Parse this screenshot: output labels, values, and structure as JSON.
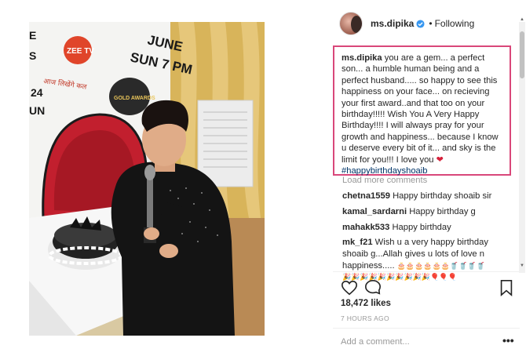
{
  "post": {
    "username": "ms.dipika",
    "separator": "•",
    "follow_state": "Following",
    "photo": {
      "banner_top": "JUNE",
      "banner_time": "SUN 7 PM",
      "brand": "ZEE TV",
      "brand_tagline": "आज लिखेंगे कल",
      "awards_logo": "GOLD AWARDS",
      "side_text_24": "24",
      "side_text_un": "UN"
    }
  },
  "caption": {
    "username": "ms.dipika",
    "text": "you are a gem... a perfect son... a humble human being and a perfect husband..... so happy to see this happiness on your face... on recieving your first award..and that too on your birthday!!!!! Wish You A Very Happy Birthday!!!! I will always pray for your growth and happiness... because I know u deserve every bit of it... and sky is the limit for you!!! I love you",
    "heart": "❤",
    "hashtag": "#happybirthdayshoaib"
  },
  "load_more": "Load more comments",
  "comments": [
    {
      "user": "chetna1559",
      "text": "Happy birthday shoaib sir"
    },
    {
      "user": "kamal_sardarni",
      "text": "Happy birthday g"
    },
    {
      "user": "mahakk533",
      "text": "Happy birthday"
    },
    {
      "user": "mk_f21",
      "text": "Wish u a very happy birthday shoaib g...Allah gives u lots of love n happiness....."
    }
  ],
  "emoji_row_1": "🎂🎂🎂🎂🎂🎂🥤🥤🥤🥤",
  "emoji_row_2": "🎉🎉🎉🎉🎉🎉🎉🎉🎉🎉🎈🎈🎈",
  "actions": {
    "like_icon": "heart-outline-icon",
    "comment_icon": "speech-bubble-icon",
    "save_icon": "bookmark-icon"
  },
  "likes": "18,472 likes",
  "time_ago": "7 HOURS AGO",
  "comment_placeholder": "Add a comment...",
  "more_options": "•••",
  "colors": {
    "caption_border": "#d9477a",
    "hashtag": "#003569",
    "muted": "#999999",
    "verified": "#3897f0"
  }
}
